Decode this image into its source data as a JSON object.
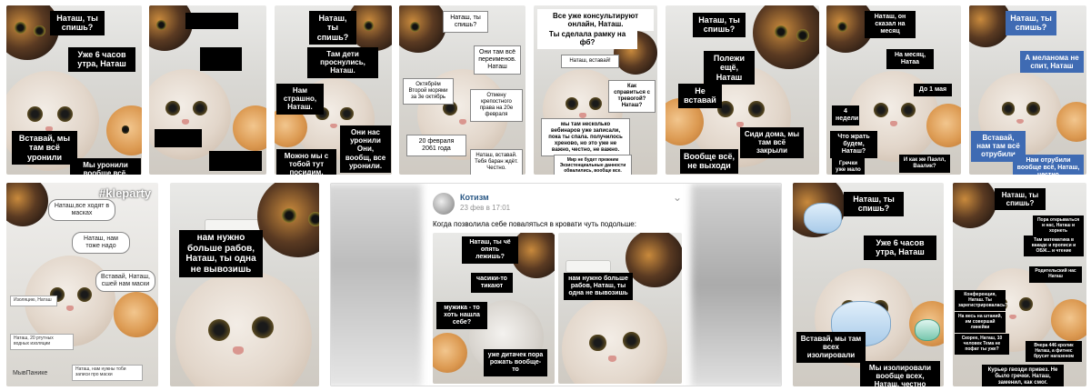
{
  "row1": [
    {
      "captions": [
        "Наташ, ты спишь?",
        "Уже 6 часов утра, Наташ",
        "Вставай, мы там всё уронили",
        "Мы уронили вообще всё, Наташ, честно"
      ]
    },
    {
      "captions": []
    },
    {
      "captions": [
        "Наташ, ты спишь?",
        "Там дети проснулись, Наташ.",
        "Нам страшно, Наташ.",
        "Они нас уронили Они, вообщ, все уронили.",
        "Можно мы с тобой тут посидим, Наташ."
      ]
    },
    {
      "captions": [
        "Наташ, ты спишь?",
        "Они там всё переименов. Наташ",
        "Октябрём Второй морями за 3е октябрь",
        "Отмену крепостного права на 20е февраля",
        "20 февраля 2061 года",
        "Наташ, вставай. Тебя баран ждёт. Честно."
      ]
    },
    {
      "captions": [
        "Все уже консультируют онлайн, Наташ.",
        "Ты сделала рамку на фб?",
        "Наташ, вставай!",
        "Как справиться с тревогой? Наташ?",
        "мы там несколько вебинаров уже записали, пока ты спала. получилось хреново, но это уже не важно, честно, не важно.",
        "Мир не будет прежним Экзистенциальные данности обвалились, вообще все."
      ]
    },
    {
      "captions": [
        "Наташ, ты спишь?",
        "Полежи ещё, Наташ",
        "Не вставай",
        "Сиди дома, мы там всё закрыли",
        "Вообще всё, не выходи"
      ]
    },
    {
      "captions": [
        "Наташ, он сказал на месяц",
        "На месяц, Натаа",
        "До 1 мая",
        "4 недели",
        "Что жрать будем, Наташ?",
        "Гречки уже мало",
        "И как же Паэлл, Ваалик?"
      ]
    },
    {
      "captions": [
        "Наташ, ты спишь?",
        "А меланома не спит, Наташ",
        "Вставай, нам там всё отрубили",
        "Нам отрубили вообще всё, Наташ, честно"
      ]
    }
  ],
  "row2": [
    {
      "watermark": "#kleparty",
      "captions": [
        "Наташ,все ходят в масках",
        "Наташ, нам тоже надо",
        "Вставай, Наташ, сшей нам маски",
        "Изоляцию, Наташ",
        "Наташ, 20 ртутных водных изоляции",
        "МывПанике",
        "Наташ, нам нужны тоби записи про маски"
      ]
    },
    {
      "captions": [
        "нам нужно больше рабов, Наташ, ты одна не вывозишь"
      ]
    },
    {
      "post": {
        "author": "Котизм",
        "date": "23 фев в 17:01",
        "text": "Когда позволила себе поваляться в кровати чуть подольше:",
        "left_captions": [
          "Наташ, ты чё опять лежишь?",
          "часики-то тикают",
          "мужика - то хоть нашла себе?",
          "уже дитачек пора рожать вообще-то"
        ],
        "right_captions": [
          "нам нужно больше рабов, Наташ, ты одна не вывозишь"
        ]
      }
    },
    {
      "captions": [
        "Наташ, ты спишь?",
        "Уже 6 часов утра, Наташ",
        "Вставай, мы там всех изолировали",
        "Мы изолировали вообще всех, Наташ, честно"
      ]
    },
    {
      "captions": [
        "Наташ, ты спишь?",
        "Пора открываться и нас, Наташ и хорнеть",
        "Там математика в вакаде и прописи и ОБЖ... и чтение",
        "Родительский нас Наташ",
        "Конференция, Наташ. Ты зарегистрировалась?",
        "На весь на штаний, им совершай линейки",
        "Скорее, Наташ, 10 человек Тема не пофат ты уже?",
        "Вчера 446 кролик Наташ, а фитнес брусит нагазеном",
        "Курьер гвозди привез. Не было гречки. Наташ, заменил, как смог."
      ]
    }
  ],
  "colors": {
    "caption_bg": "#000000",
    "caption_fg": "#ffffff",
    "accent_blue": "#3f6bb3"
  }
}
